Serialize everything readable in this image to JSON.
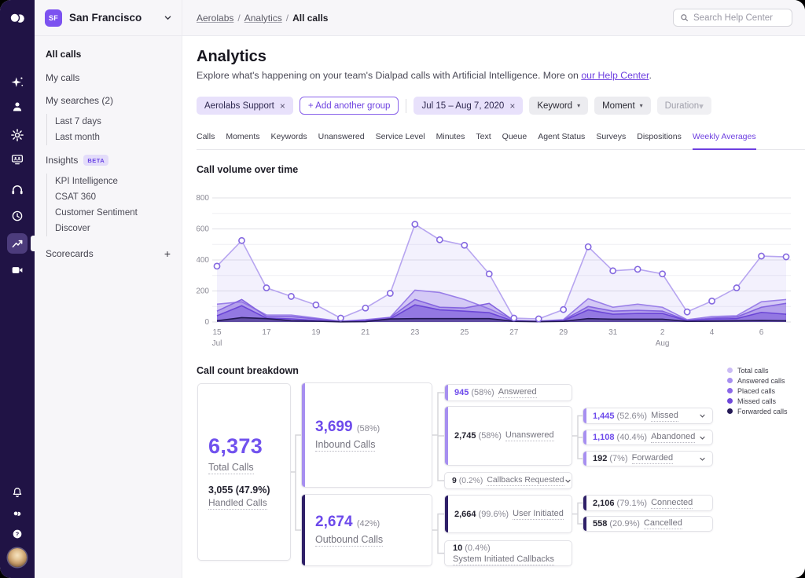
{
  "sidebar": {
    "workspace": {
      "initials": "SF",
      "name": "San Francisco"
    },
    "all_calls": "All calls",
    "my_calls": "My calls",
    "my_searches": "My searches (2)",
    "searches": [
      "Last 7 days",
      "Last month"
    ],
    "insights": "Insights",
    "insights_badge": "BETA",
    "insights_items": [
      "KPI Intelligence",
      "CSAT 360",
      "Customer Sentiment",
      "Discover"
    ],
    "scorecards": "Scorecards",
    "scorecards_add": "+"
  },
  "topbar": {
    "breadcrumb": [
      "Aerolabs",
      "Analytics",
      "All calls"
    ],
    "search_placeholder": "Search Help Center"
  },
  "header": {
    "title": "Analytics",
    "description": "Explore what's happening on your team's Dialpad calls with Artificial Intelligence. More on ",
    "link_text": "our Help Center",
    "suffix": "."
  },
  "filters": {
    "group_chip": "Aerolabs Support",
    "add_group": "+ Add another group",
    "date_chip": "Jul 15 – Aug 7, 2020",
    "keyword": "Keyword",
    "moment": "Moment",
    "duration": "Duration"
  },
  "tabs": {
    "items": [
      "Calls",
      "Moments",
      "Keywords",
      "Unanswered",
      "Service Level",
      "Minutes",
      "Text",
      "Queue",
      "Agent Status",
      "Surveys",
      "Dispositions",
      "Weekly Averages"
    ],
    "active": "Weekly Averages"
  },
  "chart_data": {
    "type": "area",
    "title": "Call volume over time",
    "x": [
      "Jul 15",
      "Jul 16",
      "Jul 17",
      "Jul 18",
      "Jul 19",
      "Jul 20",
      "Jul 21",
      "Jul 22",
      "Jul 23",
      "Jul 24",
      "Jul 25",
      "Jul 26",
      "Jul 27",
      "Jul 28",
      "Jul 29",
      "Jul 30",
      "Jul 31",
      "Aug 1",
      "Aug 2",
      "Aug 3",
      "Aug 4",
      "Aug 5",
      "Aug 6",
      "Aug 7"
    ],
    "tick_labels": [
      "15",
      "17",
      "19",
      "21",
      "23",
      "25",
      "27",
      "29",
      "31",
      "2",
      "4",
      "6"
    ],
    "month_labels": [
      {
        "text": "Jul",
        "index": 0
      },
      {
        "text": "Aug",
        "index": 18
      }
    ],
    "ylim": [
      0,
      800
    ],
    "yticks": [
      0,
      200,
      400,
      600,
      800
    ],
    "series": [
      {
        "name": "Total calls",
        "color": "#b7a5f0",
        "fill": "rgba(183,165,240,0.16)",
        "markers": true,
        "values": [
          360,
          525,
          220,
          165,
          110,
          25,
          90,
          185,
          630,
          530,
          495,
          310,
          25,
          20,
          80,
          485,
          330,
          340,
          310,
          65,
          135,
          220,
          425,
          420
        ]
      },
      {
        "name": "Answered calls",
        "color": "#9a7fe8",
        "fill": "rgba(154,127,232,0.35)",
        "markers": false,
        "values": [
          115,
          130,
          45,
          45,
          25,
          5,
          15,
          30,
          205,
          190,
          145,
          85,
          12,
          6,
          15,
          150,
          95,
          115,
          95,
          15,
          35,
          40,
          130,
          145
        ]
      },
      {
        "name": "Placed calls",
        "color": "#8463df",
        "fill": "rgba(132,99,223,0.40)",
        "markers": false,
        "values": [
          70,
          145,
          35,
          35,
          20,
          3,
          10,
          28,
          145,
          95,
          90,
          120,
          8,
          4,
          12,
          100,
          70,
          75,
          70,
          10,
          25,
          32,
          95,
          120
        ]
      },
      {
        "name": "Missed calls",
        "color": "#6b46d6",
        "fill": "rgba(107,70,214,0.45)",
        "markers": false,
        "values": [
          40,
          105,
          25,
          20,
          10,
          2,
          8,
          20,
          110,
          78,
          70,
          60,
          5,
          3,
          8,
          78,
          50,
          55,
          55,
          8,
          18,
          22,
          62,
          50
        ]
      },
      {
        "name": "Forwarded calls",
        "color": "#241956",
        "fill": "rgba(36,25,86,0.45)",
        "markers": false,
        "values": [
          8,
          28,
          22,
          8,
          5,
          1,
          2,
          20,
          22,
          22,
          22,
          22,
          4,
          2,
          4,
          22,
          18,
          18,
          18,
          4,
          6,
          8,
          10,
          8
        ]
      }
    ]
  },
  "legend": {
    "items": [
      {
        "label": "Total calls",
        "color": "#cbbcf5"
      },
      {
        "label": "Answered calls",
        "color": "#a78ff0"
      },
      {
        "label": "Placed calls",
        "color": "#8b68e8"
      },
      {
        "label": "Missed calls",
        "color": "#6f48da"
      },
      {
        "label": "Forwarded calls",
        "color": "#241956"
      }
    ]
  },
  "breakdown": {
    "title": "Call count breakdown",
    "total": {
      "value": "6,373",
      "label": "Total Calls",
      "sub_value": "3,055 (47.9%)",
      "sub_label": "Handled Calls"
    },
    "inbound": {
      "value": "3,699",
      "pct": "(58%)",
      "label": "Inbound Calls"
    },
    "outbound": {
      "value": "2,674",
      "pct": "(42%)",
      "label": "Outbound Calls"
    },
    "answered": {
      "value": "945",
      "pct": "(58%)",
      "label": "Answered"
    },
    "unanswered": {
      "value": "2,745",
      "pct": "(58%)",
      "label": "Unanswered"
    },
    "callbacks_requested": {
      "value": "9",
      "pct": "(0.2%)",
      "label": "Callbacks Requested"
    },
    "user_initiated": {
      "value": "2,664",
      "pct": "(99.6%)",
      "label": "User Initiated"
    },
    "system_initiated": {
      "value": "10",
      "pct": "(0.4%)",
      "label": "System Initiated Callbacks"
    },
    "missed": {
      "value": "1,445",
      "pct": "(52.6%)",
      "label": "Missed"
    },
    "abandoned": {
      "value": "1,108",
      "pct": "(40.4%)",
      "label": "Abandoned"
    },
    "forwarded": {
      "value": "192",
      "pct": "(7%)",
      "label": "Forwarded"
    },
    "connected": {
      "value": "2,106",
      "pct": "(79.1%)",
      "label": "Connected"
    },
    "cancelled": {
      "value": "558",
      "pct": "(20.9%)",
      "label": "Cancelled"
    }
  }
}
